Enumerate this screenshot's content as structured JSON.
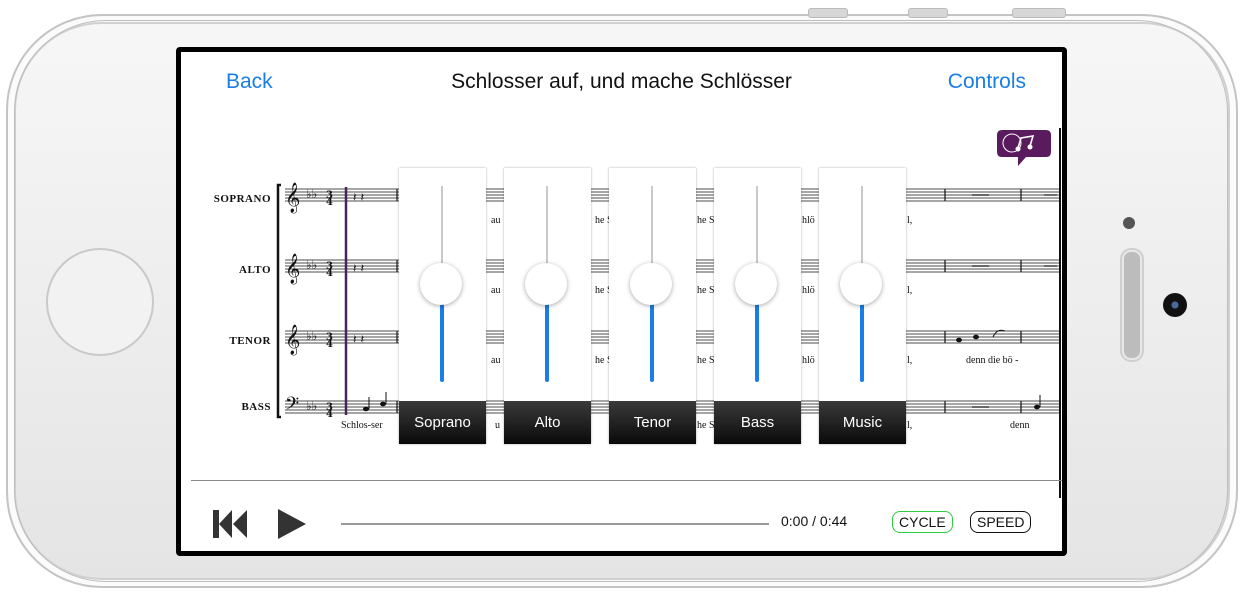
{
  "header": {
    "back_label": "Back",
    "title": "Schlosser auf, und mache Schlösser",
    "controls_label": "Controls"
  },
  "score": {
    "parts": [
      "SOPRANO",
      "ALTO",
      "TENOR",
      "BASS"
    ],
    "lyrics": {
      "au": "au",
      "he_s": "he S",
      "schlo": "hlö",
      "l_comma": "l,",
      "denn_die_bo": "denn die    bö  -",
      "schlos_ser": "Schlos-ser",
      "u": "u",
      "denn": "denn"
    }
  },
  "mixer": {
    "channels": [
      {
        "label": "Soprano",
        "level": 0.5
      },
      {
        "label": "Alto",
        "level": 0.5
      },
      {
        "label": "Tenor",
        "level": 0.5
      },
      {
        "label": "Bass",
        "level": 0.5
      },
      {
        "label": "Music",
        "level": 0.5
      }
    ]
  },
  "player": {
    "time": "0:00 / 0:44",
    "progress": 0,
    "cycle_label": "CYCLE",
    "speed_label": "SPEED",
    "icons": {
      "previous": "skip-to-start-icon",
      "play": "play-icon"
    }
  },
  "colors": {
    "accent": "#1a7ee6",
    "cycle_border": "#2ecc40",
    "logo": "#5a1a5e"
  }
}
